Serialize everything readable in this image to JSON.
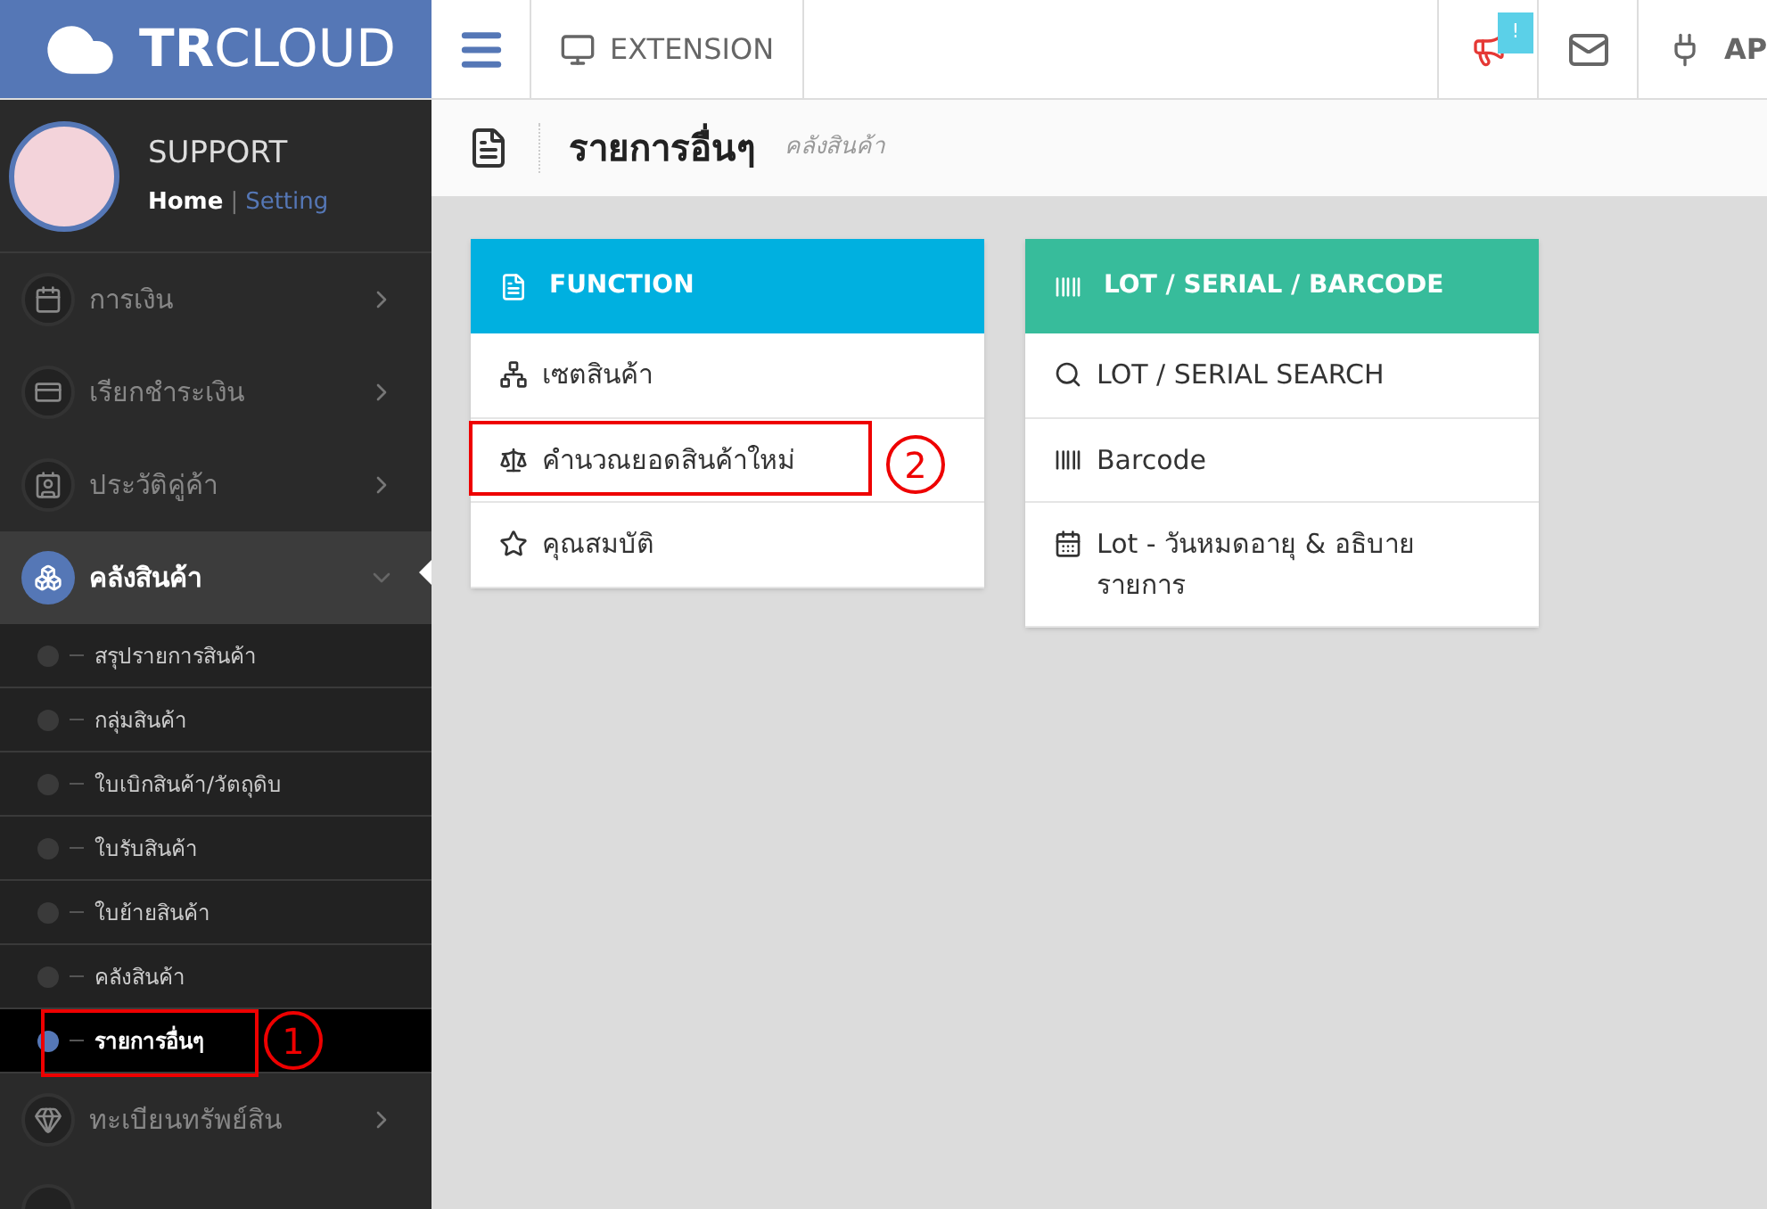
{
  "brand": {
    "name_bold": "TR",
    "name_light": "CLOUD"
  },
  "topbar": {
    "extension": "EXTENSION",
    "notification_badge": "!",
    "apps_label": "AP"
  },
  "user": {
    "name": "SUPPORT",
    "home": "Home",
    "separator": "|",
    "setting": "Setting"
  },
  "sidebar": {
    "items": [
      {
        "label": "การเงิน",
        "expanded": false,
        "selected": false
      },
      {
        "label": "เรียกชำระเงิน",
        "expanded": false,
        "selected": false
      },
      {
        "label": "ประวัติคู่ค้า",
        "expanded": false,
        "selected": false
      },
      {
        "label": "คลังสินค้า",
        "expanded": true,
        "selected": true,
        "children": [
          {
            "label": "สรุปรายการสินค้า",
            "selected": false
          },
          {
            "label": "กลุ่มสินค้า",
            "selected": false
          },
          {
            "label": "ใบเบิกสินค้า/วัตถุดิบ",
            "selected": false
          },
          {
            "label": "ใบรับสินค้า",
            "selected": false
          },
          {
            "label": "ใบย้ายสินค้า",
            "selected": false
          },
          {
            "label": "คลังสินค้า",
            "selected": false
          },
          {
            "label": "รายการอื่นๆ",
            "selected": true
          }
        ]
      },
      {
        "label": "ทะเบียนทรัพย์สิน",
        "expanded": false,
        "selected": false
      }
    ]
  },
  "page_header": {
    "title": "รายการอื่นๆ",
    "breadcrumb": "คลังสินค้า"
  },
  "cards": [
    {
      "title": "FUNCTION",
      "color": "#00b0e0",
      "items": [
        "เซตสินค้า",
        "คำนวณยอดสินค้าใหม่",
        "คุณสมบัติ"
      ]
    },
    {
      "title": "LOT / SERIAL / BARCODE",
      "color": "#37bc9b",
      "items": [
        "LOT / SERIAL SEARCH",
        "Barcode",
        "Lot - วันหมดอายุ & อธิบายรายการ"
      ]
    }
  ],
  "annotations": [
    {
      "label": "1"
    },
    {
      "label": "2"
    }
  ]
}
